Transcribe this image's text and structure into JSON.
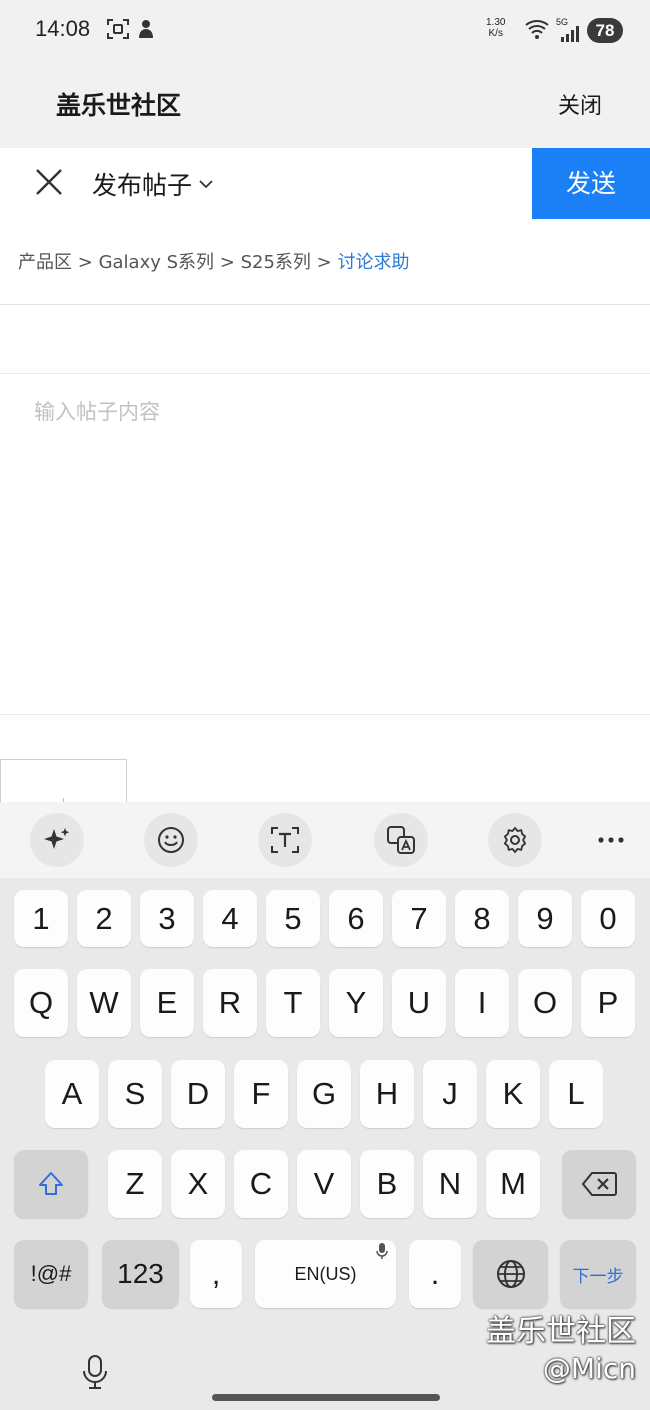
{
  "status_bar": {
    "time": "14:08",
    "net_speed_value": "1.30",
    "net_speed_unit": "K/s",
    "battery": "78",
    "network": "5G"
  },
  "app_header": {
    "title": "盖乐世社区",
    "close_label": "关闭"
  },
  "compose": {
    "post_type": "发布帖子",
    "send_label": "发送"
  },
  "breadcrumb": {
    "items": [
      "产品区",
      "Galaxy S系列",
      "S25系列"
    ],
    "separator": ">",
    "current": "讨论求助"
  },
  "editor": {
    "title_value": "",
    "content_placeholder": "输入帖子内容"
  },
  "keyboard_toolbar": {
    "icons": [
      "sparkle-icon",
      "emoji-icon",
      "text-recognition-icon",
      "translate-icon",
      "settings-icon",
      "more-icon"
    ],
    "more_label": "···"
  },
  "keyboard": {
    "row_numbers": [
      "1",
      "2",
      "3",
      "4",
      "5",
      "6",
      "7",
      "8",
      "9",
      "0"
    ],
    "row_qwerty": [
      "Q",
      "W",
      "E",
      "R",
      "T",
      "Y",
      "U",
      "I",
      "O",
      "P"
    ],
    "row_asdf": [
      "A",
      "S",
      "D",
      "F",
      "G",
      "H",
      "J",
      "K",
      "L"
    ],
    "row_zxcv": [
      "Z",
      "X",
      "C",
      "V",
      "B",
      "N",
      "M"
    ],
    "symbols_label": "!@#",
    "numbers_label": "123",
    "comma_label": ",",
    "space_label": "EN(US)",
    "period_label": ".",
    "next_label": "下一步"
  },
  "watermark": {
    "line1": "盖乐世社区",
    "line2": "@Micn"
  },
  "colors": {
    "accent": "#1b7ff5",
    "breadcrumb_current": "#2a7ad8",
    "keyboard_bg": "#e9e9e9"
  }
}
